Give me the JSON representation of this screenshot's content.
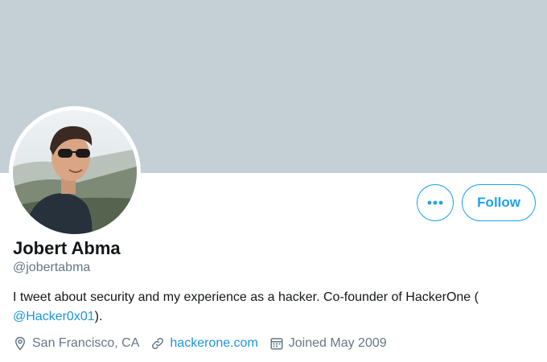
{
  "profile": {
    "name": "Jobert Abma",
    "handle": "@jobertabma",
    "bio_text": "I tweet about security and my experience as a hacker. Co-founder of HackerOne (",
    "bio_mention": "@Hacker0x01",
    "bio_suffix": ").",
    "location": "San Francisco, CA",
    "website": "hackerone.com",
    "joined": "Joined May 2009"
  },
  "actions": {
    "more_label": "•••",
    "follow_label": "Follow"
  },
  "icons": {
    "more": "more-dots-icon",
    "location": "location-pin-icon",
    "link": "link-icon",
    "calendar": "calendar-icon"
  },
  "colors": {
    "banner": "#c4cfd6",
    "accent": "#1da1f2",
    "link": "#1b95e0",
    "secondary_text": "#657786"
  }
}
